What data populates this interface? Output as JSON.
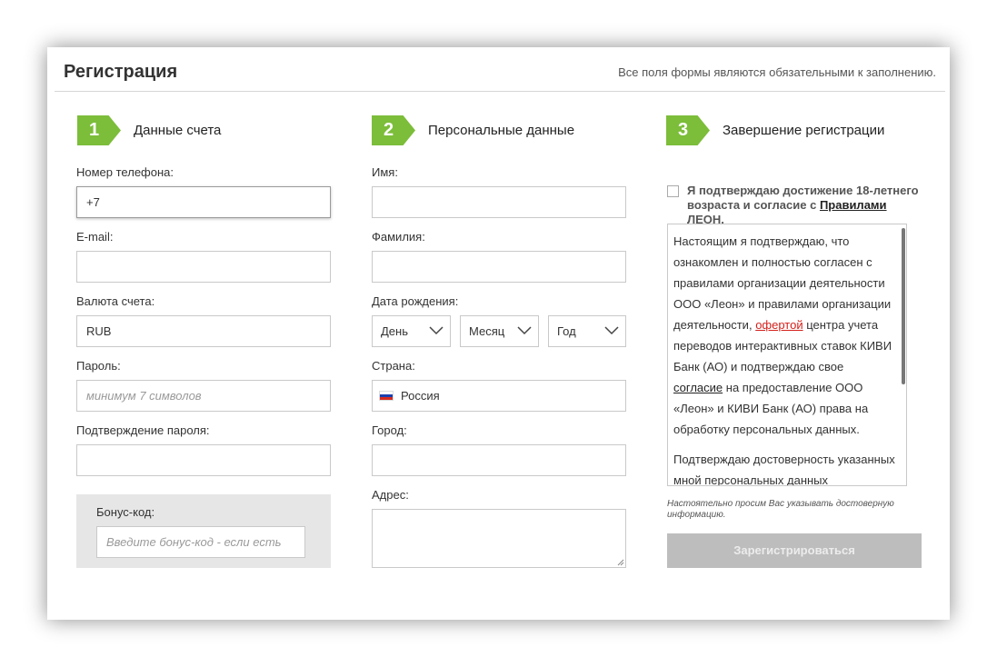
{
  "header": {
    "title": "Регистрация",
    "note": "Все поля формы являются обязательными к заполнению."
  },
  "steps": [
    {
      "number": "1",
      "title": "Данные счета"
    },
    {
      "number": "2",
      "title": "Персональные данные"
    },
    {
      "number": "3",
      "title": "Завершение регистрации"
    }
  ],
  "account": {
    "phone_label": "Номер телефона:",
    "phone_value": "+7",
    "email_label": "E-mail:",
    "currency_label": "Валюта счета:",
    "currency_value": "RUB",
    "password_label": "Пароль:",
    "password_placeholder": "минимум 7 символов",
    "password_confirm_label": "Подтверждение пароля:",
    "bonus_label": "Бонус-код:",
    "bonus_placeholder": "Введите бонус-код - если есть"
  },
  "personal": {
    "first_name_label": "Имя:",
    "last_name_label": "Фамилия:",
    "birth_label": "Дата рождения:",
    "day": "День",
    "month": "Месяц",
    "year": "Год",
    "country_label": "Страна:",
    "country_value": "Россия",
    "city_label": "Город:",
    "address_label": "Адрес:"
  },
  "finish": {
    "agree_prefix": "Я подтверждаю достижение 18-летнего возраста и согласие с",
    "agree_link": "Правилами",
    "agree_suffix": "ЛЕОН.",
    "terms_p1_a": "Настоящим я подтверждаю, что ознакомлен и полностью согласен с правилами организации деятельности ООО «Леон» и правилами организации деятельности,",
    "terms_p1_link1": "офертой",
    "terms_p1_b": "центра учета переводов интерактивных ставок КИВИ Банк (АО) и подтверждаю свое",
    "terms_p1_link2": "согласие",
    "terms_p1_c": "на предоставление ООО «Леон» и КИВИ Банк (АО) права на обработку персональных данных.",
    "terms_p2": "Подтверждаю достоверность указанных мной персональных данных",
    "hint": "Настоятельно просим Вас указывать достоверную информацию.",
    "submit": "Зарегистрироваться"
  },
  "colors": {
    "accent": "#7cbd3a",
    "link_red": "#d4201a",
    "button_disabled": "#bdbdbd"
  },
  "icons": {
    "select_arrow": "chevron-down-icon",
    "country_flag": "russia-flag-icon"
  }
}
